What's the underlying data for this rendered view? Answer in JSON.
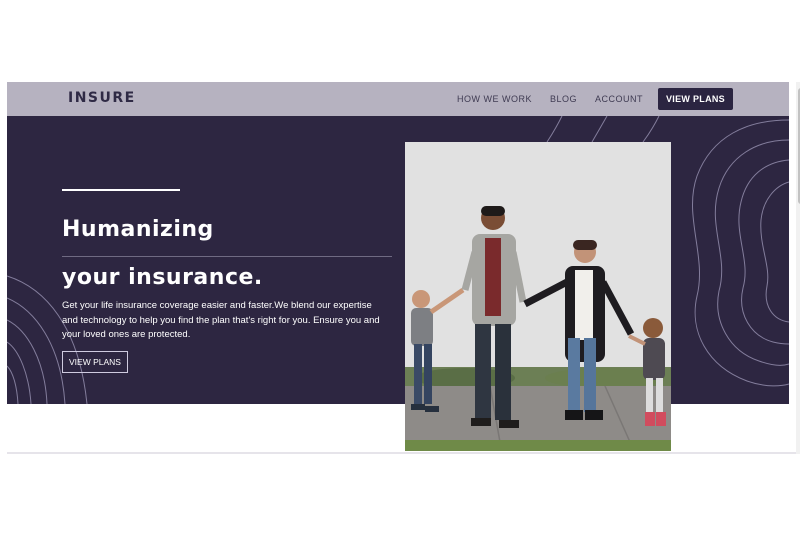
{
  "brand": {
    "logo": "INSURE"
  },
  "nav": {
    "links": [
      "HOW WE WORK",
      "BLOG",
      "ACCOUNT"
    ],
    "cta": "VIEW PLANS"
  },
  "hero": {
    "heading_line1": "Humanizing",
    "heading_line2": "your insurance.",
    "subtext": "Get your life insurance coverage easier and faster.We blend our expertise and technology to help you find the plan that's right for you. Ensure you and your loved ones are protected.",
    "button": "VIEW PLANS"
  },
  "colors": {
    "navbar": "#b6b2c0",
    "hero_bg": "#2d2641",
    "accent_dark": "#2b2541",
    "text_light": "#ffffff"
  }
}
